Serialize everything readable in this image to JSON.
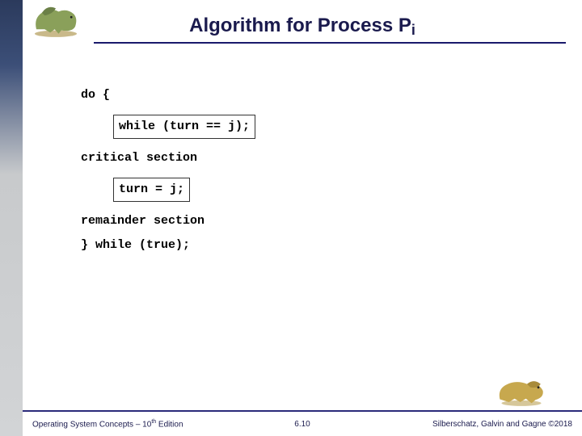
{
  "header": {
    "title_main": "Algorithm for Process P",
    "title_sub": "i"
  },
  "code": {
    "l1": "do {",
    "l2": "while (turn == j);",
    "l3": "critical section",
    "l4": "turn = j;",
    "l5": "remainder section",
    "l6": "} while (true);"
  },
  "footer": {
    "left_a": "Operating System Concepts – 10",
    "left_sup": "th",
    "left_b": " Edition",
    "center": "6.10",
    "right": "Silberschatz, Galvin and Gagne ©2018"
  },
  "icons": {
    "dino_top": "dinosaur-icon",
    "dino_bottom": "dinosaur-icon"
  }
}
